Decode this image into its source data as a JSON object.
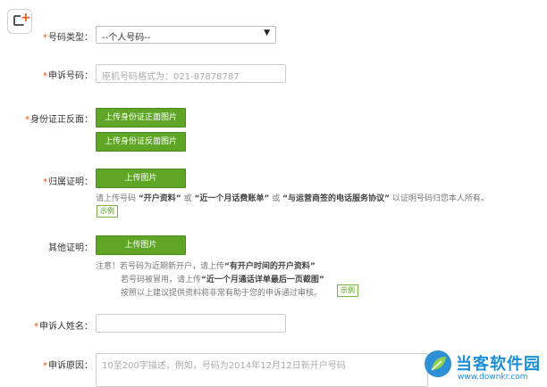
{
  "form": {
    "number_type": {
      "label": "号码类型：",
      "value": "--个人号码--"
    },
    "appeal_number": {
      "label": "申诉号码：",
      "placeholder": "座机号码格式为：021-87878787"
    },
    "id_card": {
      "label": "身份证正反面：",
      "front_button": "上传身份证正面图片",
      "back_button": "上传身份证反面图片"
    },
    "ownership": {
      "label": "归属证明：",
      "upload_button": "上传图片",
      "hint_parts": [
        "请上传号码",
        "“开户资料”",
        "或",
        "“近一个月话费账单”",
        "或",
        "“与运营商签的电话服务协议”",
        "以证明号码归您本人所有。"
      ],
      "sample": "示例"
    },
    "other_proof": {
      "label": "其他证明：",
      "upload_button": "上传图片",
      "note_line1_parts": [
        "注意！若号码为近期新开户，请上传",
        "“有开户时间的开户资料”"
      ],
      "note_line2_parts": [
        "若号码被冒用，请上传",
        "“近一个月通话详单最后一页截图”"
      ],
      "note_line3": "按照以上建议提供资料将非常有助于您的申诉通过审核。",
      "sample": "示例"
    },
    "appellant_name": {
      "label": "申诉人姓名：",
      "value": ""
    },
    "reason": {
      "label": "申诉原因：",
      "placeholder": "10至200字描述，例如，号码为2014年12月12日新开户号码"
    }
  },
  "watermark": {
    "brand": "当客软件园",
    "url": "www.downkr.com"
  },
  "colors": {
    "accent": "#e4551e",
    "button_green": "#5fa526",
    "watermark_blue": "#1a8fd8"
  },
  "icons": {
    "corner": "add-box-icon",
    "dropdown": "caret-down-icon",
    "watermark": "leaf-logo-icon"
  }
}
